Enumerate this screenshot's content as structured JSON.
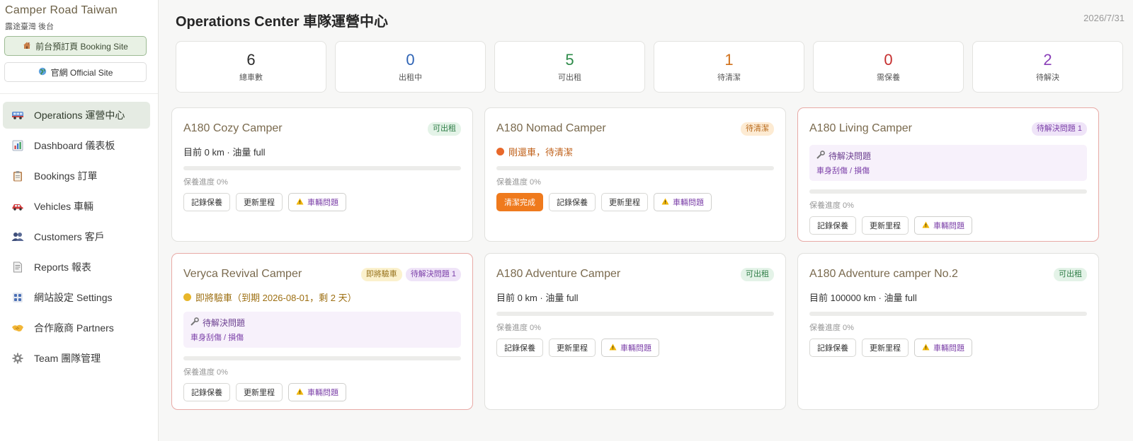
{
  "sidebar": {
    "brand": "Camper Road Taiwan",
    "brand_sub": "露途臺灣 後台",
    "booking_site": "前台預訂頁 Booking Site",
    "official_site": "官網 Official Site",
    "items": [
      {
        "label": "Operations 運營中心",
        "icon": "campervan-icon"
      },
      {
        "label": "Dashboard 儀表板",
        "icon": "bar-chart-icon"
      },
      {
        "label": "Bookings 訂單",
        "icon": "clipboard-icon"
      },
      {
        "label": "Vehicles 車輛",
        "icon": "car-icon"
      },
      {
        "label": "Customers 客戶",
        "icon": "people-icon"
      },
      {
        "label": "Reports 報表",
        "icon": "document-icon"
      },
      {
        "label": "網站設定 Settings",
        "icon": "control-knobs-icon"
      },
      {
        "label": "合作廠商 Partners",
        "icon": "handshake-icon"
      },
      {
        "label": "Team 團隊管理",
        "icon": "gear-icon"
      }
    ]
  },
  "header": {
    "title": "Operations Center 車隊運營中心",
    "date": "2026/7/31"
  },
  "stats": [
    {
      "value": "6",
      "label": "總車數",
      "color": "#2b2b2b"
    },
    {
      "value": "0",
      "label": "出租中",
      "color": "#2f64b5"
    },
    {
      "value": "5",
      "label": "可出租",
      "color": "#2e8b4a"
    },
    {
      "value": "1",
      "label": "待清潔",
      "color": "#d0701a"
    },
    {
      "value": "0",
      "label": "需保養",
      "color": "#c62f2f"
    },
    {
      "value": "2",
      "label": "待解決",
      "color": "#8a3fb8"
    }
  ],
  "common": {
    "progress_label": "保養進度 0%",
    "progress_value": 0,
    "btn_maintenance": "記錄保養",
    "btn_mileage": "更新里程",
    "btn_issue": "車輛問題",
    "btn_clean_done": "清潔完成",
    "issue_title": "待解決問題",
    "issue_desc": "車身刮傷 / 損傷"
  },
  "vehicles": [
    {
      "name": "A180 Cozy Camper",
      "badges": [
        {
          "text": "可出租",
          "type": "green"
        }
      ],
      "status": "目前 0 km · 油量 full"
    },
    {
      "name": "A180 Nomad Camper",
      "badges": [
        {
          "text": "待清潔",
          "type": "orange"
        }
      ],
      "status": "剛還車，待清潔"
    },
    {
      "name": "A180 Living Camper",
      "badges": [
        {
          "text": "待解決問題 1",
          "type": "purple"
        }
      ]
    },
    {
      "name": "Veryca Revival Camper",
      "badges": [
        {
          "text": "即將驗車",
          "type": "yellow"
        },
        {
          "text": "待解決問題 1",
          "type": "purple"
        }
      ],
      "status": "即將驗車（到期 2026-08-01，剩 2 天）"
    },
    {
      "name": "A180 Adventure Camper",
      "badges": [
        {
          "text": "可出租",
          "type": "green"
        }
      ],
      "status": "目前 0 km · 油量 full"
    },
    {
      "name": "A180 Adventure camper No.2",
      "badges": [
        {
          "text": "可出租",
          "type": "green"
        }
      ],
      "status": "目前 100000 km · 油量 full"
    }
  ]
}
